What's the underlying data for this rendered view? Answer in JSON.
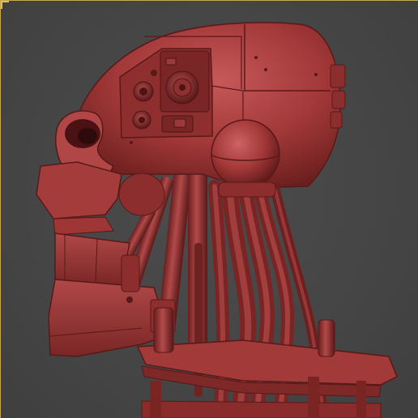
{
  "viewport": {
    "background": "#464646",
    "border_color": "#c8a848"
  },
  "model": {
    "subject": "robot-skull-head-sculpt",
    "material_color": "#9e3434",
    "highlight_color": "#c55454",
    "shadow_color": "#5e1a1a"
  }
}
